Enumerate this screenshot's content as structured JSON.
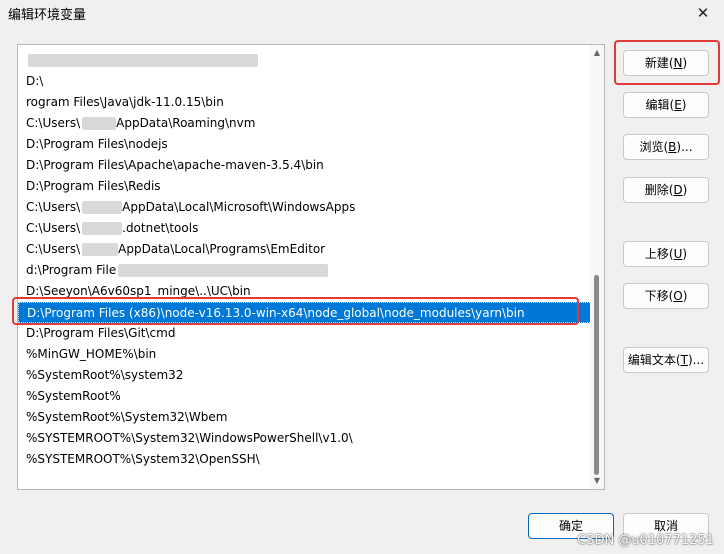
{
  "window": {
    "title": "编辑环境变量",
    "close_glyph": "✕"
  },
  "list": {
    "items": [
      "",
      "D:\\",
      "rogram Files\\Java\\jdk-11.0.15\\bin",
      "C:\\Users\\",
      "D:\\Program Files\\nodejs",
      "D:\\Program Files\\Apache\\apache-maven-3.5.4\\bin",
      "D:\\Program Files\\Redis",
      "C:\\Users\\",
      "C:\\Users\\",
      "C:\\Users\\",
      "d:\\Program File",
      "D:\\Seeyon\\A6v60sp1_minge\\..\\UC\\bin",
      "D:\\Program Files (x86)\\node-v16.13.0-win-x64\\node_global\\node_modules\\yarn\\bin",
      "D:\\Program Files\\Git\\cmd",
      "%MinGW_HOME%\\bin",
      "%SystemRoot%\\system32",
      "%SystemRoot%",
      "%SystemRoot%\\System32\\Wbem",
      "%SYSTEMROOT%\\System32\\WindowsPowerShell\\v1.0\\",
      "%SYSTEMROOT%\\System32\\OpenSSH\\"
    ],
    "tails": {
      "3": "AppData\\Roaming\\nvm",
      "7": "AppData\\Local\\Microsoft\\WindowsApps",
      "8": ".dotnet\\tools",
      "9": "AppData\\Local\\Programs\\EmEditor"
    },
    "selected_index": 12
  },
  "buttons": {
    "new": {
      "label": "新建(",
      "key": "N",
      "end": ")"
    },
    "edit": {
      "label": "编辑(",
      "key": "E",
      "end": ")"
    },
    "browse": {
      "label": "浏览(",
      "key": "B",
      "end": ")..."
    },
    "delete": {
      "label": "删除(",
      "key": "D",
      "end": ")"
    },
    "up": {
      "label": "上移(",
      "key": "U",
      "end": ")"
    },
    "down": {
      "label": "下移(",
      "key": "O",
      "end": ")"
    },
    "edit_text": {
      "label": "编辑文本(",
      "key": "T",
      "end": ")..."
    },
    "ok": "确定",
    "cancel": "取消"
  },
  "watermark": "CSDN @u010771251",
  "colors": {
    "selection": "#0078d7",
    "highlight": "#e23a3a"
  }
}
